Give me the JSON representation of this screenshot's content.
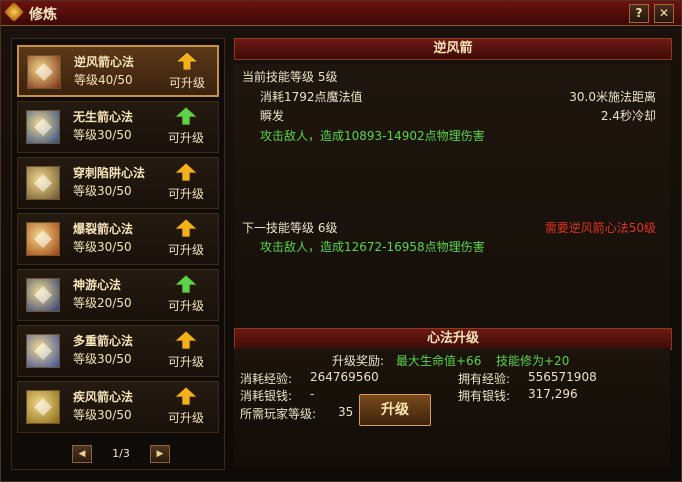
{
  "window": {
    "title": "修炼",
    "help_label": "?",
    "close_label": "✕"
  },
  "skills": [
    {
      "name": "逆风箭心法",
      "level": "等级40/50",
      "status": "可升级",
      "arrow": "up-arrow-gold-icon",
      "icon": "arrow-skill-icon",
      "selected": true
    },
    {
      "name": "无生箭心法",
      "level": "等级30/50",
      "status": "可升级",
      "arrow": "up-arrow-green-icon",
      "icon": "blue-arrow-skill-icon",
      "selected": false
    },
    {
      "name": "穿刺陷阱心法",
      "level": "等级30/50",
      "status": "可升级",
      "arrow": "up-arrow-gold-icon",
      "icon": "trap-skill-icon",
      "selected": false
    },
    {
      "name": "爆裂箭心法",
      "level": "等级30/50",
      "status": "可升级",
      "arrow": "up-arrow-gold-icon",
      "icon": "explosion-skill-icon",
      "selected": false
    },
    {
      "name": "神游心法",
      "level": "等级20/50",
      "status": "可升级",
      "arrow": "up-arrow-green-icon",
      "icon": "wander-skill-icon",
      "selected": false
    },
    {
      "name": "多重箭心法",
      "level": "等级30/50",
      "status": "可升级",
      "arrow": "up-arrow-gold-icon",
      "icon": "multi-arrow-skill-icon",
      "selected": false
    },
    {
      "name": "疾风箭心法",
      "level": "等级30/50",
      "status": "可升级",
      "arrow": "up-arrow-gold-icon",
      "icon": "gale-arrow-skill-icon",
      "selected": false
    }
  ],
  "pager": {
    "prev": "◀",
    "next": "▶",
    "page": "1/3"
  },
  "detail": {
    "title": "逆风箭",
    "current_level_label": "当前技能等级 5级",
    "mana_cost": "消耗1792点魔法值",
    "range": "30.0米施法距离",
    "cast": "瞬发",
    "cooldown": "2.4秒冷却",
    "current_effect": "攻击敌人，造成10893-14902点物理伤害",
    "next_level_label": "下一技能等级 6级",
    "requirement": "需要逆风箭心法50级",
    "next_effect": "攻击敌人，造成12672-16958点物理伤害"
  },
  "upgrade": {
    "title": "心法升级",
    "reward_label": "升级奖励:",
    "reward_hp": "最大生命值+66",
    "reward_cultivation": "技能修为+20",
    "exp_cost_label": "消耗经验:",
    "exp_cost_value": "264769560",
    "exp_own_label": "拥有经验:",
    "exp_own_value": "556571908",
    "silver_cost_label": "消耗银钱:",
    "silver_cost_value": "-",
    "silver_own_label": "拥有银钱:",
    "silver_own_value": "317,296",
    "player_level_label": "所需玩家等级:",
    "player_level_value": "35",
    "button_label": "升级"
  },
  "colors": {
    "accent": "#c89046",
    "green": "#5bd34a",
    "red": "#e1331d",
    "gold": "#f3b21c"
  }
}
